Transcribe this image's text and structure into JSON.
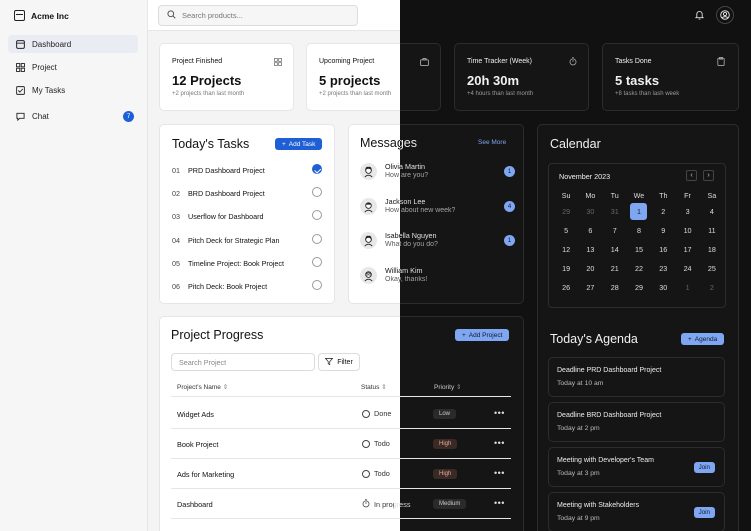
{
  "app": {
    "name": "Acme Inc"
  },
  "sidebar": {
    "items": [
      {
        "label": "Dashboard",
        "icon": "home-icon"
      },
      {
        "label": "Project",
        "icon": "grid-icon"
      },
      {
        "label": "My Tasks",
        "icon": "task-icon"
      },
      {
        "label": "Chat",
        "icon": "chat-icon",
        "badge": "7"
      }
    ]
  },
  "header": {
    "search_placeholder": "Search products..."
  },
  "stats": [
    {
      "label": "Project Finished",
      "value": "12 Projects",
      "sub": "+2 projects than last month"
    },
    {
      "label": "Upcoming Project",
      "value": "5 projects",
      "sub": "+2 projects than last month"
    },
    {
      "label": "Time Tracker (Week)",
      "value": "20h 30m",
      "sub": "+4 hours than last month"
    },
    {
      "label": "Tasks Done",
      "value": "5 tasks",
      "sub": "+8 tasks than lash week"
    }
  ],
  "tasks": {
    "title": "Today's Tasks",
    "add_label": "Add Task",
    "items": [
      {
        "num": "01",
        "label": "PRD Dashboard Project",
        "done": true
      },
      {
        "num": "02",
        "label": "BRD Dashboard Project",
        "done": false
      },
      {
        "num": "03",
        "label": "Userflow for Dashboard",
        "done": false
      },
      {
        "num": "04",
        "label": "Pitch Deck for Strategic Plan",
        "done": false
      },
      {
        "num": "05",
        "label": "Timeline Project: Book Project",
        "done": false
      },
      {
        "num": "06",
        "label": "Pitch Deck: Book Project",
        "done": false
      }
    ]
  },
  "messages": {
    "title": "Messages",
    "see_more": "See More",
    "items": [
      {
        "name": "Olivia Martin",
        "text": "How are you?",
        "badge": "1"
      },
      {
        "name": "Jackson Lee",
        "text": "How about new week?",
        "badge": "4"
      },
      {
        "name": "Isabella Nguyen",
        "text": "What do you do?",
        "badge": "1"
      },
      {
        "name": "William Kim",
        "text": "Okay, thanks!",
        "badge": ""
      }
    ]
  },
  "calendar": {
    "title": "Calendar",
    "month": "November 2023",
    "weekdays": [
      "Su",
      "Mo",
      "Tu",
      "We",
      "Th",
      "Fr",
      "Sa"
    ],
    "days": [
      [
        "29",
        "30",
        "31",
        "1",
        "2",
        "3",
        "4"
      ],
      [
        "5",
        "6",
        "7",
        "8",
        "9",
        "10",
        "11"
      ],
      [
        "12",
        "13",
        "14",
        "15",
        "16",
        "17",
        "18"
      ],
      [
        "19",
        "20",
        "21",
        "22",
        "23",
        "24",
        "25"
      ],
      [
        "26",
        "27",
        "28",
        "29",
        "30",
        "1",
        "2"
      ]
    ],
    "selected": "1"
  },
  "agenda": {
    "title": "Today's Agenda",
    "add_label": "Agenda",
    "items": [
      {
        "title": "Deadline PRD Dashboard Project",
        "time": "Today at 10 am",
        "action": ""
      },
      {
        "title": "Deadline BRD Dashboard Project",
        "time": "Today at 2 pm",
        "action": ""
      },
      {
        "title": "Meeting with Developer's Team",
        "time": "Today at 3 pm",
        "action": "Join"
      },
      {
        "title": "Meeting with Stakeholders",
        "time": "Today at 9 pm",
        "action": "Join"
      }
    ]
  },
  "progress": {
    "title": "Project Progress",
    "add_label": "Add Project",
    "search_placeholder": "Search Project",
    "filter_label": "Filter",
    "columns": [
      "Project's Name",
      "Status",
      "Priority"
    ],
    "rows": [
      {
        "name": "Widget Ads",
        "status": "Done",
        "priority": "Low"
      },
      {
        "name": "Book Project",
        "status": "Todo",
        "priority": "High"
      },
      {
        "name": "Ads for Marketing",
        "status": "Todo",
        "priority": "High"
      },
      {
        "name": "Dashboard",
        "status": "In progress",
        "priority": "Medium"
      }
    ],
    "more": "•••"
  },
  "colors": {
    "accent": "#1f5fd6",
    "accent_light": "#7fa6f0",
    "dark_bg": "#111111"
  }
}
